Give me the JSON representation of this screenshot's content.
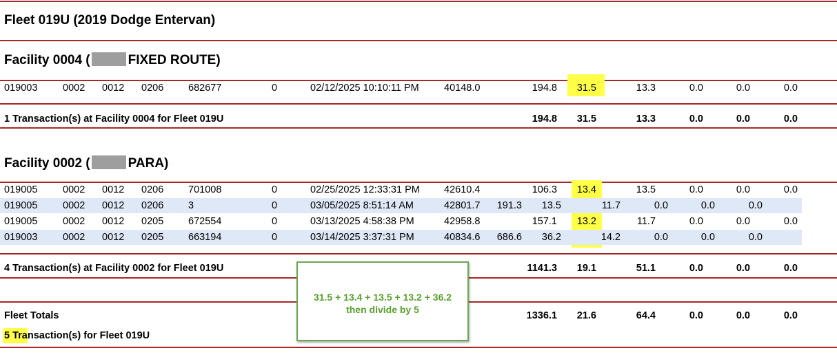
{
  "fleet_title": "Fleet 019U (2019 Dodge Entervan)",
  "facility_a": {
    "prefix": "Facility 0004 (",
    "suffix": "FIXED ROUTE)"
  },
  "facility_b": {
    "prefix": "Facility 0002 (",
    "suffix": "PARA)"
  },
  "rows_a": [
    [
      "019003",
      "0002",
      "0012",
      "0206",
      "682677",
      "0",
      "02/12/2025 10:10:11 PM",
      "40148.0",
      "194.8",
      "31.5",
      "13.3",
      "0.0",
      "0.0",
      "0.0"
    ]
  ],
  "summary_a": {
    "label": "1 Transaction(s) at Facility 0004 for Fleet 019U",
    "v1": "194.8",
    "v2": "31.5",
    "v3": "13.3",
    "v4": "0.0",
    "v5": "0.0",
    "v6": "0.0"
  },
  "rows_b": [
    [
      "019005",
      "0002",
      "0012",
      "0206",
      "701008",
      "0",
      "02/25/2025 12:33:31 PM",
      "42610.4",
      "106.3",
      "13.4",
      "13.5",
      "0.0",
      "0.0",
      "0.0"
    ],
    [
      "019005",
      "0002",
      "0012",
      "0206",
      "3",
      "0",
      "03/05/2025 8:51:14 AM",
      "42801.7",
      "191.3",
      "13.5",
      "11.7",
      "0.0",
      "0.0",
      "0.0"
    ],
    [
      "019005",
      "0002",
      "0012",
      "0205",
      "672554",
      "0",
      "03/13/2025 4:58:38 PM",
      "42958.8",
      "157.1",
      "13.2",
      "11.7",
      "0.0",
      "0.0",
      "0.0"
    ],
    [
      "019003",
      "0002",
      "0012",
      "0205",
      "663194",
      "0",
      "03/14/2025 3:37:31 PM",
      "40834.6",
      "686.6",
      "36.2",
      "14.2",
      "0.0",
      "0.0",
      "0.0"
    ]
  ],
  "summary_b": {
    "label": "4 Transaction(s) at Facility 0002 for Fleet 019U",
    "v1": "1141.3",
    "v2": "19.1",
    "v3": "51.1",
    "v4": "0.0",
    "v5": "0.0",
    "v6": "0.0"
  },
  "fleet_totals": {
    "label": "Fleet Totals",
    "v1": "1336.1",
    "v2": "21.6",
    "v3": "64.4",
    "v4": "0.0",
    "v5": "0.0",
    "v6": "0.0"
  },
  "fleet_transactions": "5 Transaction(s) for Fleet 019U",
  "callout": {
    "line1": "31.5 + 13.4 + 13.5 + 13.2 + 36.2",
    "line2": "then divide by 5"
  },
  "colors": {
    "rule": "#a52828",
    "highlight": "#ffff47",
    "row_shade": "#dfe8f6",
    "callout_text": "#5aa02c"
  }
}
